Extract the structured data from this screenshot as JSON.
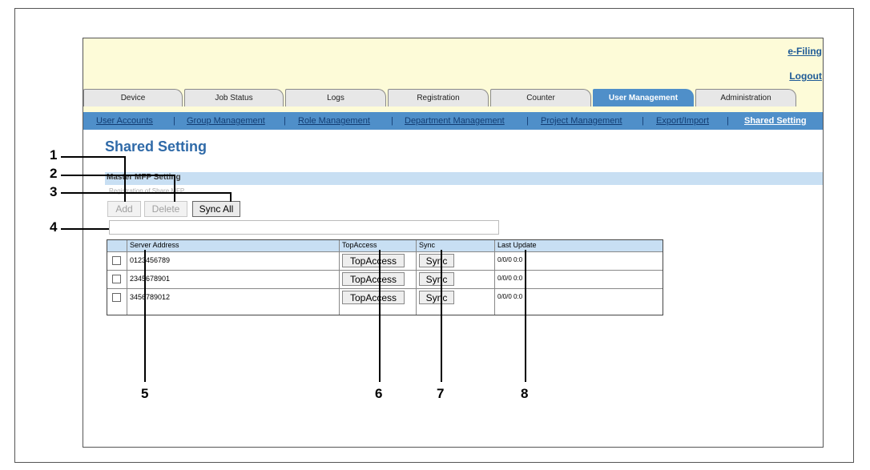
{
  "header": {
    "efiling_link": "e-Filing",
    "logout_link": "Logout"
  },
  "tabs": [
    "Device",
    "Job Status",
    "Logs",
    "Registration",
    "Counter",
    "User Management",
    "Administration"
  ],
  "subnav": [
    "User Accounts",
    "Group Management",
    "Role Management",
    "Department Management",
    "Project Management",
    "Export/Import",
    "Shared Setting"
  ],
  "page_title": "Shared Setting",
  "section": {
    "title": "Master MFP Setting",
    "sublabel": "Registration of Share MFP"
  },
  "buttons": {
    "add": "Add",
    "delete": "Delete",
    "sync_all": "Sync All"
  },
  "table": {
    "headers": [
      "Server Address",
      "TopAccess",
      "Sync",
      "Last Update"
    ],
    "rows": [
      {
        "address": "0123456789",
        "topaccess": "TopAccess",
        "sync": "Sync",
        "last_update": "0/0/0 0:0"
      },
      {
        "address": "2345678901",
        "topaccess": "TopAccess",
        "sync": "Sync",
        "last_update": "0/0/0 0:0"
      },
      {
        "address": "3456789012",
        "topaccess": "TopAccess",
        "sync": "Sync",
        "last_update": "0/0/0 0:0"
      }
    ]
  },
  "callouts": [
    "1",
    "2",
    "3",
    "4",
    "5",
    "6",
    "7",
    "8"
  ]
}
